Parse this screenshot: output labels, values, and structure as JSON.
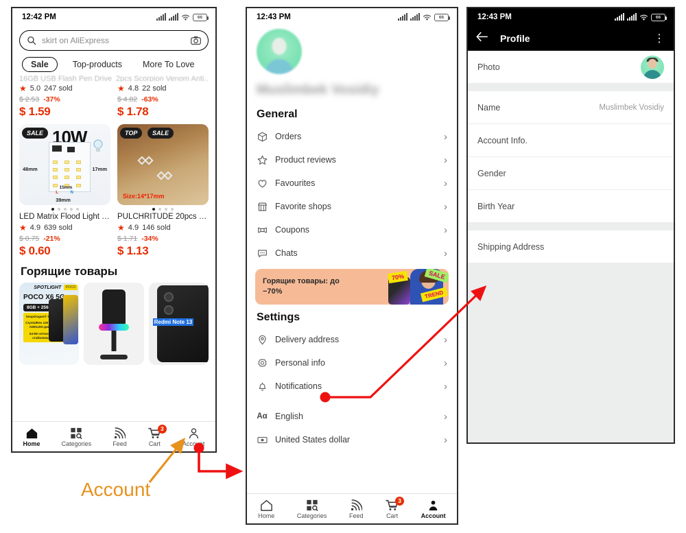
{
  "colors": {
    "accent_red": "#e62e04",
    "annotation_orange": "#e8921e",
    "annotation_red": "#ee1111",
    "promo_bg": "#f6bb96",
    "avatar_green": "#72dfae"
  },
  "phone_home": {
    "status_bar": {
      "time": "12:42 PM",
      "battery": "66"
    },
    "search": {
      "placeholder": "skirt on AliExpress",
      "search_icon": "search-icon",
      "camera_icon": "camera-icon"
    },
    "tabs": [
      {
        "label": "Sale",
        "active": true
      },
      {
        "label": "Top-products",
        "active": false
      },
      {
        "label": "More To Love",
        "active": false
      }
    ],
    "clipped_titles": [
      "16GB USB Flash Pen Drive ...",
      "2pcs Scorpion Venom Anti..."
    ],
    "products_top": [
      {
        "rating": "5.0",
        "sold": "247 sold",
        "old_price": "$ 2.53",
        "discount": "-37%",
        "price": "$ 1.59"
      },
      {
        "rating": "4.8",
        "sold": "22 sold",
        "old_price": "$ 4.82",
        "discount": "-63%",
        "price": "$ 1.78"
      }
    ],
    "products_main": [
      {
        "badges": [
          "SALE"
        ],
        "image_text": {
          "watts": "10W",
          "dim_left": "48mm",
          "dim_right": "17mm",
          "dim_inner": "15mm",
          "dim_bottom": "39mm",
          "live": "L",
          "neutral": "N"
        },
        "title": "LED Matrix Flood Light SMD...",
        "rating": "4.9",
        "sold": "639 sold",
        "old_price": "$ 0.75",
        "discount": "-21%",
        "price": "$ 0.60"
      },
      {
        "badges": [
          "TOP",
          "SALE"
        ],
        "image_text": {
          "size": "Size:14*17mm"
        },
        "title": "PULCHRITUDE 20pcs 14*1...",
        "rating": "4.9",
        "sold": "146 sold",
        "old_price": "$ 1.71",
        "discount": "-34%",
        "price": "$ 1.13"
      }
    ],
    "hot_section_title": "Горящие товары",
    "hot_cards": [
      {
        "brand": "SPOTLIGHT",
        "name": "POCO X6 5G",
        "memory": "8GB + 256GB",
        "spec1": "Snapdragon® 7s Gen 2",
        "spec2": "CrystalRes 120 Гц Flow AMOLED-дисплей",
        "spec3": "64 Мп оптическая стабилизация"
      },
      {
        "name": ""
      },
      {
        "name": "Redmi Note 13 "
      }
    ],
    "bottom_nav": [
      {
        "label": "Home",
        "icon": "home-icon",
        "active": true,
        "badge": ""
      },
      {
        "label": "Categories",
        "icon": "categories-icon",
        "active": false,
        "badge": ""
      },
      {
        "label": "Feed",
        "icon": "feed-icon",
        "active": false,
        "badge": ""
      },
      {
        "label": "Cart",
        "icon": "cart-icon",
        "active": false,
        "badge": "3"
      },
      {
        "label": "Account",
        "icon": "account-icon",
        "active": false,
        "badge": ""
      }
    ]
  },
  "phone_account": {
    "status_bar": {
      "time": "12:43 PM",
      "battery": "66"
    },
    "user_name": "Muslimbek Vosidiy",
    "general_title": "General",
    "general_items": [
      {
        "label": "Orders",
        "icon": "box-icon"
      },
      {
        "label": "Product reviews",
        "icon": "star-outline-icon"
      },
      {
        "label": "Favourites",
        "icon": "heart-icon"
      },
      {
        "label": "Favorite shops",
        "icon": "shop-icon"
      },
      {
        "label": "Coupons",
        "icon": "coupon-icon"
      },
      {
        "label": "Chats",
        "icon": "chat-icon"
      }
    ],
    "promo": {
      "text": "Горящие товары: до −70%",
      "tag_70": "70%",
      "tag_sale": "SALE",
      "tag_trend": "TREND"
    },
    "settings_title": "Settings",
    "settings_items": [
      {
        "label": "Delivery address",
        "icon": "location-pin-icon"
      },
      {
        "label": "Personal info",
        "icon": "gear-icon"
      },
      {
        "label": "Notifications",
        "icon": "bell-icon"
      }
    ],
    "preference_items": [
      {
        "label": "English",
        "icon": "language-icon"
      },
      {
        "label": "United States dollar",
        "icon": "currency-icon"
      }
    ],
    "bottom_nav": [
      {
        "label": "Home",
        "icon": "home-icon",
        "active": false,
        "badge": ""
      },
      {
        "label": "Categories",
        "icon": "categories-icon",
        "active": false,
        "badge": ""
      },
      {
        "label": "Feed",
        "icon": "feed-icon",
        "active": false,
        "badge": ""
      },
      {
        "label": "Cart",
        "icon": "cart-icon",
        "active": false,
        "badge": "3"
      },
      {
        "label": "Account",
        "icon": "account-icon",
        "active": true,
        "badge": ""
      }
    ]
  },
  "phone_profile": {
    "status_bar": {
      "time": "12:43 PM",
      "battery": "66"
    },
    "appbar": {
      "title": "Profile",
      "back_icon": "back-arrow-icon",
      "menu_icon": "kebab-menu-icon"
    },
    "rows": [
      {
        "label": "Photo",
        "value": ""
      },
      {
        "label": "Name",
        "value": "Muslimbek Vosidiy"
      },
      {
        "label": "Account Info.",
        "value": ""
      },
      {
        "label": "Gender",
        "value": ""
      },
      {
        "label": "Birth Year",
        "value": ""
      },
      {
        "label": "Shipping Address",
        "value": ""
      }
    ]
  },
  "annotations": {
    "account_label": "Account"
  }
}
